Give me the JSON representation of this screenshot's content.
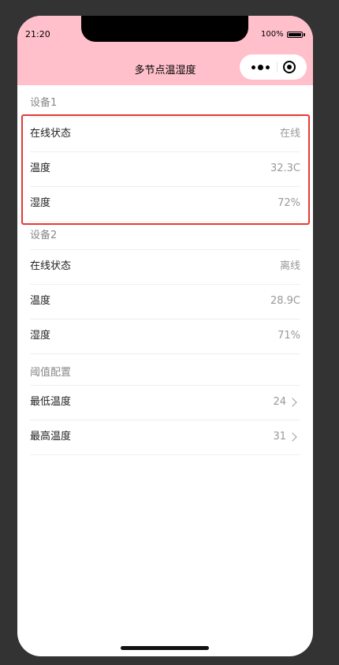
{
  "status_bar": {
    "time": "21:20",
    "battery": "100%"
  },
  "nav": {
    "title": "多节点温湿度"
  },
  "groups": [
    {
      "title": "设备1",
      "rows": [
        {
          "label": "在线状态",
          "value": "在线"
        },
        {
          "label": "温度",
          "value": "32.3C"
        },
        {
          "label": "湿度",
          "value": "72%"
        }
      ]
    },
    {
      "title": "设备2",
      "rows": [
        {
          "label": "在线状态",
          "value": "离线"
        },
        {
          "label": "温度",
          "value": "28.9C"
        },
        {
          "label": "湿度",
          "value": "71%"
        }
      ]
    },
    {
      "title": "阈值配置",
      "rows": [
        {
          "label": "最低温度",
          "value": "24"
        },
        {
          "label": "最高温度",
          "value": "31"
        }
      ]
    }
  ],
  "colors": {
    "header_bg": "#ffc0cb",
    "highlight_border": "#e53935"
  }
}
